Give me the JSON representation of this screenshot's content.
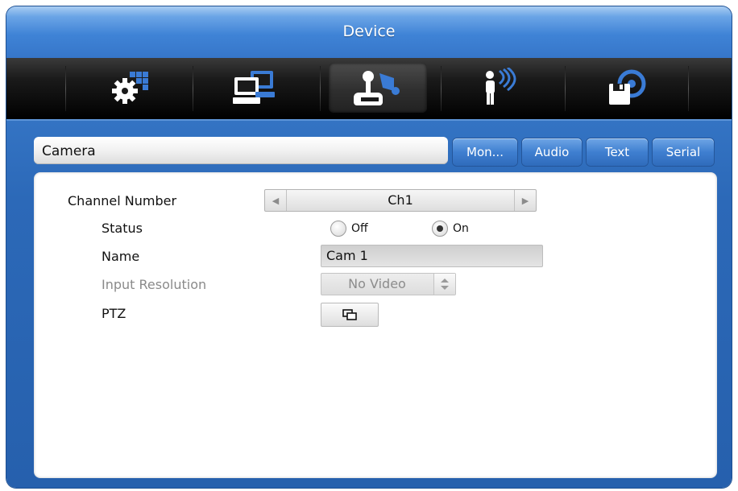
{
  "window": {
    "title": "Device"
  },
  "categories": [
    {
      "name": "system-setup",
      "icon": "gear-grid-icon",
      "active": false
    },
    {
      "name": "network",
      "icon": "computer-network-icon",
      "active": false
    },
    {
      "name": "device",
      "icon": "joystick-camera-icon",
      "active": true
    },
    {
      "name": "event",
      "icon": "person-sensor-icon",
      "active": false
    },
    {
      "name": "storage",
      "icon": "disk-save-icon",
      "active": false
    }
  ],
  "section": {
    "title": "Camera"
  },
  "tabs": [
    {
      "label": "Mon..."
    },
    {
      "label": "Audio"
    },
    {
      "label": "Text"
    },
    {
      "label": "Serial"
    }
  ],
  "form": {
    "channel": {
      "label": "Channel Number",
      "value": "Ch1"
    },
    "status": {
      "label": "Status",
      "off_label": "Off",
      "on_label": "On",
      "selected": "On"
    },
    "name": {
      "label": "Name",
      "value": "Cam 1"
    },
    "resolution": {
      "label": "Input Resolution",
      "value": "No Video",
      "disabled": true
    },
    "ptz": {
      "label": "PTZ",
      "icon": "window-overlap-icon"
    }
  },
  "colors": {
    "accent": "#3676c9",
    "icon_fill": "#ffffff",
    "icon_accent": "#3a7bd5"
  }
}
